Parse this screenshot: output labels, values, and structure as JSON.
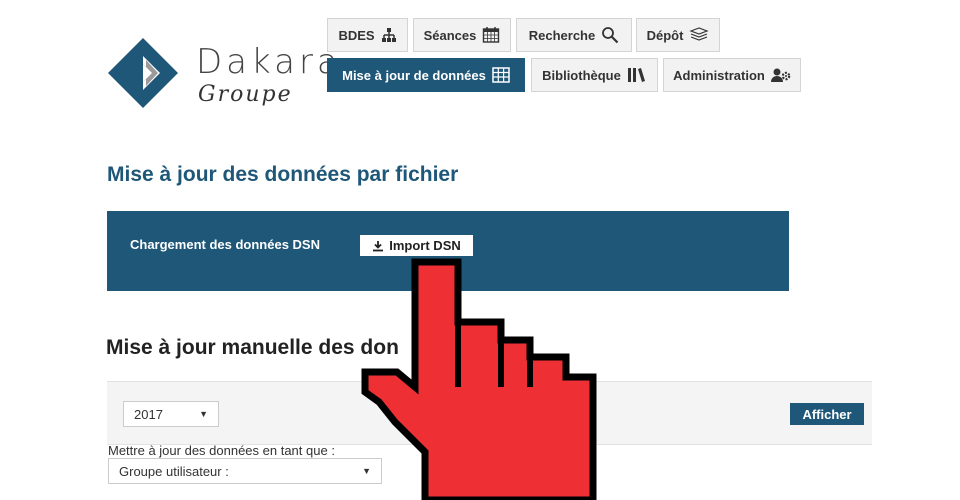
{
  "logo": {
    "name": "Dakara",
    "sub": "Groupe"
  },
  "nav": {
    "bdes": "BDES",
    "seances": "Séances",
    "recherche": "Recherche",
    "depot": "Dépôt",
    "maj": "Mise à jour de données",
    "bibliotheque": "Bibliothèque",
    "administration": "Administration"
  },
  "file_section": {
    "title": "Mise à jour des données par fichier",
    "dsn_label": "Chargement des données DSN",
    "import_button": "Import DSN"
  },
  "manual_section": {
    "title": "Mise à jour manuelle des don",
    "year_value": "2017",
    "show_button": "Afficher",
    "role_label": "Mettre à jour des données en tant que :",
    "role_value": "Groupe utilisateur :"
  },
  "colors": {
    "brand": "#1e5778",
    "cursor": "#ee3035"
  }
}
